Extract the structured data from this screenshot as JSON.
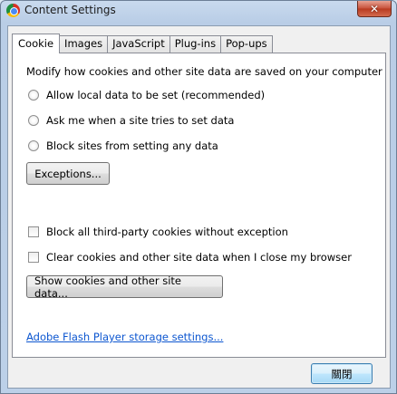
{
  "window": {
    "title": "Content Settings",
    "close_glyph": "✕"
  },
  "tabs": [
    {
      "label": "Cookie",
      "active": true
    },
    {
      "label": "Images",
      "active": false
    },
    {
      "label": "JavaScript",
      "active": false
    },
    {
      "label": "Plug-ins",
      "active": false
    },
    {
      "label": "Pop-ups",
      "active": false
    }
  ],
  "cookie_panel": {
    "intro": "Modify how cookies and other site data are saved on your computer",
    "radios": [
      {
        "label": "Allow local data to be set (recommended)",
        "checked": false
      },
      {
        "label": "Ask me when a site tries to set data",
        "checked": false
      },
      {
        "label": "Block sites from setting any data",
        "checked": false
      }
    ],
    "exceptions_button": "Exceptions...",
    "checkboxes": [
      {
        "label": "Block all third-party cookies without exception",
        "checked": false
      },
      {
        "label": "Clear cookies and other site data when I close my browser",
        "checked": false
      }
    ],
    "show_cookies_button": "Show cookies and other site data...",
    "flash_link": "Adobe Flash Player storage settings..."
  },
  "footer": {
    "close_button": "關閉"
  },
  "colors": {
    "link": "#0c56d0",
    "close_red": "#c75038"
  }
}
